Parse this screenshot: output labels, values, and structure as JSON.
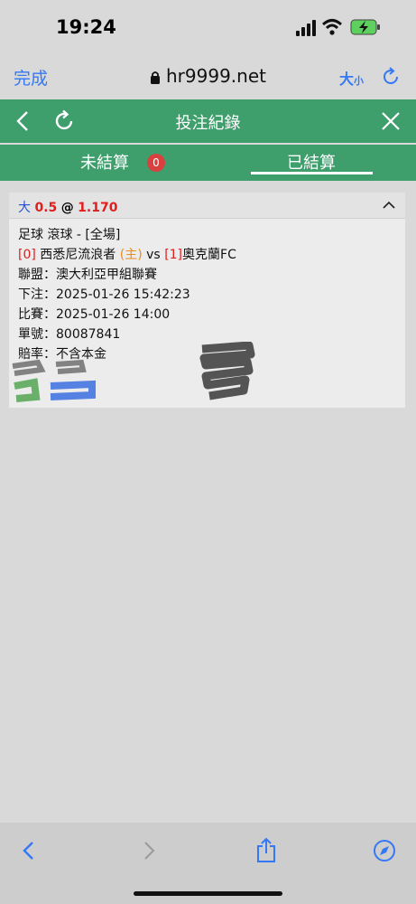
{
  "status": {
    "time": "19:24"
  },
  "browser": {
    "done_label": "完成",
    "url": "hr9999.net",
    "text_size_big": "大",
    "text_size_small": "小"
  },
  "header": {
    "title": "投注紀錄"
  },
  "tabs": [
    {
      "label": "未結算",
      "badge": "0"
    },
    {
      "label": "已結算",
      "active": true
    }
  ],
  "bet": {
    "pick": "大",
    "line": "0.5",
    "at": "@",
    "odds": "1.170",
    "sport_line": "足球 滾球 - [全場]",
    "home_score": "[0]",
    "home_team": "西悉尼流浪者",
    "home_tag": "(主)",
    "vs": "vs",
    "away_score": "[1]",
    "away_team": "奧克蘭FC",
    "league_label": "聯盟：",
    "league": "澳大利亞甲組聯賽",
    "placed_label": "下注：",
    "placed": "2025-01-26 15:42:23",
    "match_label": "比賽：",
    "match": "2025-01-26 14:00",
    "ticket_label": "單號：",
    "ticket": "80087841",
    "odds_type_label": "賠率：",
    "odds_type": "不含本金"
  },
  "colors": {
    "green": "#3e9e6c",
    "accent_blue": "#3478f6",
    "badge_red": "#d94040",
    "odds_red": "#e01e1e",
    "home_orange": "#e88c1e",
    "pick_blue": "#2152d6"
  },
  "icons": {
    "signal": "cellular-signal-icon",
    "wifi": "wifi-icon",
    "battery": "battery-charging-icon",
    "lock": "lock-icon",
    "reload": "reload-icon",
    "back": "chevron-left-icon",
    "refresh": "refresh-icon",
    "close": "close-icon",
    "collapse": "chevron-up-icon",
    "share": "share-icon",
    "compass": "compass-icon"
  }
}
